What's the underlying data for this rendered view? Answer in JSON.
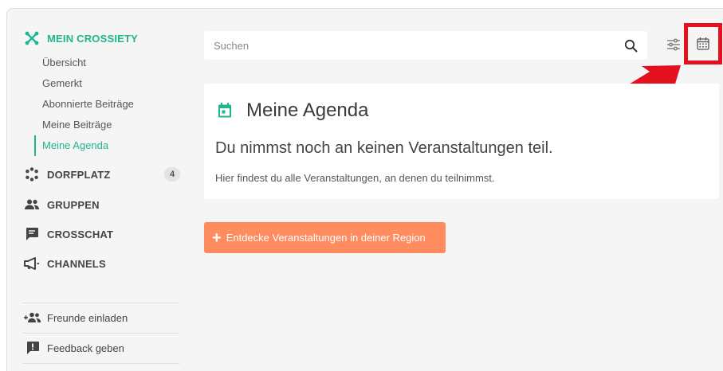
{
  "sidebar": {
    "brand": "MEIN CROSSIETY",
    "sub_items": [
      {
        "label": "Übersicht"
      },
      {
        "label": "Gemerkt"
      },
      {
        "label": "Abonnierte Beiträge"
      },
      {
        "label": "Meine Beiträge"
      },
      {
        "label": "Meine Agenda",
        "active": true
      }
    ],
    "nav": [
      {
        "label": "DORFPLATZ",
        "badge": "4",
        "icon": "dorfplatz-icon"
      },
      {
        "label": "GRUPPEN",
        "icon": "group-icon"
      },
      {
        "label": "CROSSCHAT",
        "icon": "chat-icon"
      },
      {
        "label": "CHANNELS",
        "icon": "megaphone-icon"
      }
    ],
    "footer": [
      {
        "label": "Freunde einladen",
        "icon": "add-friends-icon"
      },
      {
        "label": "Feedback geben",
        "icon": "feedback-icon"
      }
    ]
  },
  "search": {
    "placeholder": "Suchen"
  },
  "agenda": {
    "title": "Meine Agenda",
    "subtitle": "Du nimmst noch an keinen Veranstaltungen teil.",
    "description": "Hier findest du alle Veranstaltungen, an denen du teilnimmst."
  },
  "cta": {
    "label": "Entdecke Veranstaltungen in deiner Region"
  },
  "colors": {
    "accent": "#1fb58f",
    "cta": "#ff8c5e",
    "highlight": "#e3101d"
  }
}
